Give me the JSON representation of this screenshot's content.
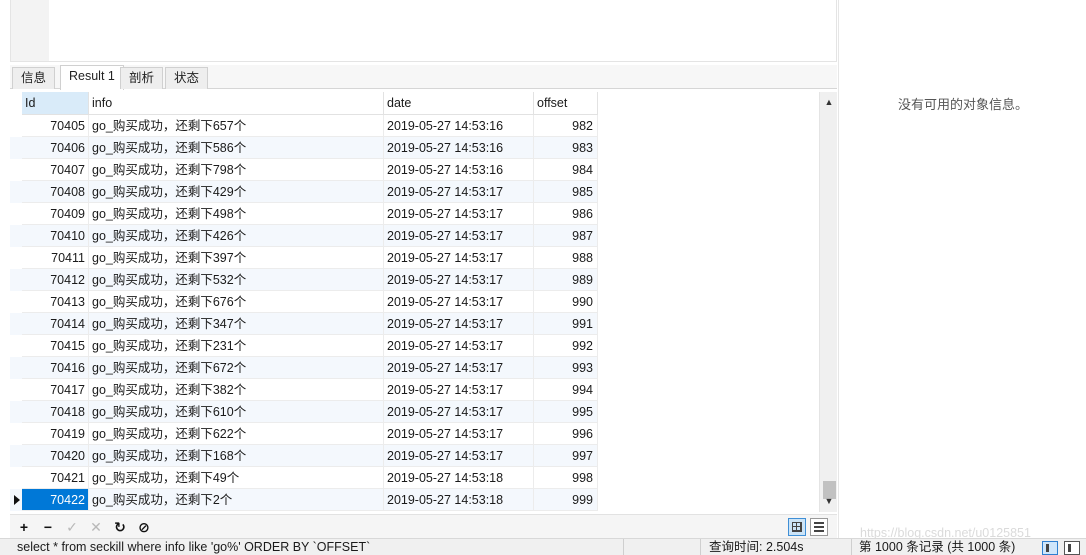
{
  "tabs": [
    {
      "label": "信息"
    },
    {
      "label": "Result 1"
    },
    {
      "label": "剖析"
    },
    {
      "label": "状态"
    }
  ],
  "active_tab": "Result 1",
  "columns": [
    "Id",
    "info",
    "date",
    "offset"
  ],
  "rows": [
    {
      "id": "70405",
      "info": "go_购买成功，还剩下657个",
      "date": "2019-05-27 14:53:16",
      "offset": "982"
    },
    {
      "id": "70406",
      "info": "go_购买成功，还剩下586个",
      "date": "2019-05-27 14:53:16",
      "offset": "983"
    },
    {
      "id": "70407",
      "info": "go_购买成功，还剩下798个",
      "date": "2019-05-27 14:53:16",
      "offset": "984"
    },
    {
      "id": "70408",
      "info": "go_购买成功，还剩下429个",
      "date": "2019-05-27 14:53:17",
      "offset": "985"
    },
    {
      "id": "70409",
      "info": "go_购买成功，还剩下498个",
      "date": "2019-05-27 14:53:17",
      "offset": "986"
    },
    {
      "id": "70410",
      "info": "go_购买成功，还剩下426个",
      "date": "2019-05-27 14:53:17",
      "offset": "987"
    },
    {
      "id": "70411",
      "info": "go_购买成功，还剩下397个",
      "date": "2019-05-27 14:53:17",
      "offset": "988"
    },
    {
      "id": "70412",
      "info": "go_购买成功，还剩下532个",
      "date": "2019-05-27 14:53:17",
      "offset": "989"
    },
    {
      "id": "70413",
      "info": "go_购买成功，还剩下676个",
      "date": "2019-05-27 14:53:17",
      "offset": "990"
    },
    {
      "id": "70414",
      "info": "go_购买成功，还剩下347个",
      "date": "2019-05-27 14:53:17",
      "offset": "991"
    },
    {
      "id": "70415",
      "info": "go_购买成功，还剩下231个",
      "date": "2019-05-27 14:53:17",
      "offset": "992"
    },
    {
      "id": "70416",
      "info": "go_购买成功，还剩下672个",
      "date": "2019-05-27 14:53:17",
      "offset": "993"
    },
    {
      "id": "70417",
      "info": "go_购买成功，还剩下382个",
      "date": "2019-05-27 14:53:17",
      "offset": "994"
    },
    {
      "id": "70418",
      "info": "go_购买成功，还剩下610个",
      "date": "2019-05-27 14:53:17",
      "offset": "995"
    },
    {
      "id": "70419",
      "info": "go_购买成功，还剩下622个",
      "date": "2019-05-27 14:53:17",
      "offset": "996"
    },
    {
      "id": "70420",
      "info": "go_购买成功，还剩下168个",
      "date": "2019-05-27 14:53:17",
      "offset": "997"
    },
    {
      "id": "70421",
      "info": "go_购买成功，还剩下49个",
      "date": "2019-05-27 14:53:18",
      "offset": "998"
    },
    {
      "id": "70422",
      "info": "go_购买成功，还剩下2个",
      "date": "2019-05-27 14:53:18",
      "offset": "999"
    }
  ],
  "selected_row_index": 17,
  "toolbar": {
    "add_icon": "plus-icon",
    "delete_icon": "minus-icon",
    "apply_icon": "check-icon",
    "discard_icon": "x-icon",
    "refresh_icon": "refresh-icon",
    "stop_icon": "stop-icon",
    "add": "+",
    "delete": "−",
    "apply": "✓",
    "discard": "✕",
    "refresh": "↻",
    "stop": "⊘"
  },
  "side_panel": {
    "message": "没有可用的对象信息。"
  },
  "status": {
    "sql": "select  * from seckill where info like 'go%' ORDER BY `OFFSET`",
    "query_time": "查询时间: 2.504s",
    "record_count": "第 1000 条记录 (共 1000 条)"
  },
  "watermark": "https://blog.csdn.net/u0125851",
  "colors": {
    "selection": "#0078d7",
    "header_highlight": "#d9ebf9",
    "alt_row": "#f4f8fd"
  }
}
